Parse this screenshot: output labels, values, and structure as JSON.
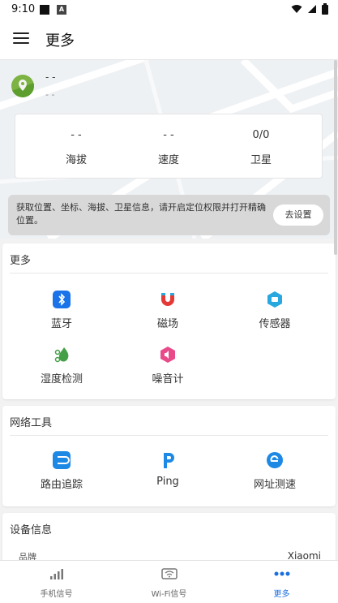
{
  "status": {
    "time": "9:10",
    "badge": "A"
  },
  "app": {
    "title": "更多"
  },
  "location": {
    "name": "- -",
    "sub": "- -"
  },
  "stats": [
    {
      "value": "- -",
      "label": "海拔"
    },
    {
      "value": "- -",
      "label": "速度"
    },
    {
      "value": "0/0",
      "label": "卫星"
    }
  ],
  "banner": {
    "text": "获取位置、坐标、海拔、卫星信息，请开启定位权限并打开精确位置。",
    "button": "去设置"
  },
  "more": {
    "title": "更多",
    "items": [
      {
        "label": "蓝牙",
        "icon": "bluetooth-icon",
        "color": "#1a73e8"
      },
      {
        "label": "磁场",
        "icon": "magnet-icon",
        "color": "#e53935"
      },
      {
        "label": "传感器",
        "icon": "sensor-icon",
        "color": "#29a8e0"
      },
      {
        "label": "湿度检测",
        "icon": "humidity-icon",
        "color": "#43a047"
      },
      {
        "label": "噪音计",
        "icon": "noise-icon",
        "color": "#e84a8a"
      }
    ]
  },
  "network": {
    "title": "网络工具",
    "items": [
      {
        "label": "路由追踪",
        "icon": "route-icon",
        "color": "#1e88e5"
      },
      {
        "label": "Ping",
        "icon": "ping-icon",
        "color": "#1e88e5"
      },
      {
        "label": "网址测速",
        "icon": "speedtest-icon",
        "color": "#1e88e5"
      }
    ]
  },
  "device": {
    "title": "设备信息",
    "brand_label": "品牌",
    "brand_value": "Xiaomi"
  },
  "nav": [
    {
      "label": "手机信号",
      "icon": "signal-bars-icon"
    },
    {
      "label": "Wi-Fi信号",
      "icon": "wifi-icon"
    },
    {
      "label": "更多",
      "icon": "more-dots-icon",
      "active": true
    }
  ],
  "colors": {
    "accent": "#1a6fe0",
    "banner_bg": "#d8d8d8"
  }
}
